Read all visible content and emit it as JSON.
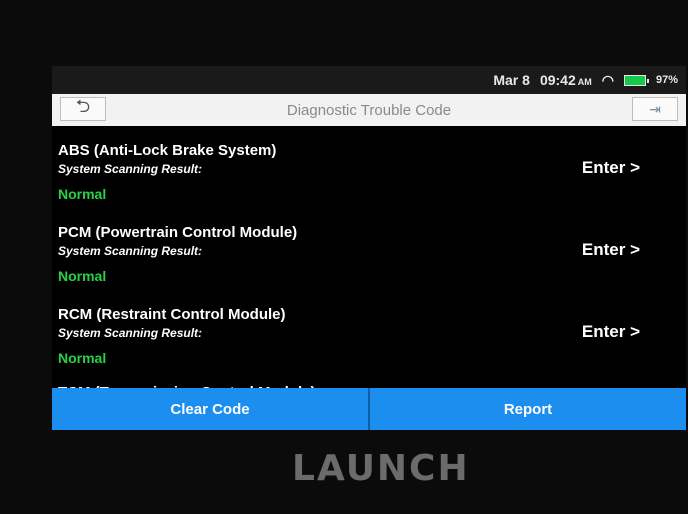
{
  "status_bar": {
    "date": "Mar 8",
    "time": "09:42",
    "ampm": "AM",
    "battery": "97%"
  },
  "header": {
    "title": "Diagnostic Trouble Code"
  },
  "modules": [
    {
      "name": "ABS (Anti-Lock Brake System)",
      "sub": "System Scanning Result:",
      "status": "Normal",
      "action": "Enter >"
    },
    {
      "name": "PCM (Powertrain Control Module)",
      "sub": "System Scanning Result:",
      "status": "Normal",
      "action": "Enter >"
    },
    {
      "name": "RCM (Restraint Control Module)",
      "sub": "System Scanning Result:",
      "status": "Normal",
      "action": "Enter >"
    }
  ],
  "partial_item": "TCM (Transmission Control Module)",
  "bottom": {
    "clear_label": "Clear Code",
    "report_label": "Report"
  },
  "device": {
    "brand": "LAUNCH"
  },
  "icons": {
    "back": "back-arrow-icon",
    "exit": "exit-icon",
    "wifi": "wifi-icon",
    "battery": "battery-icon"
  },
  "colors": {
    "normal_status": "#26d247",
    "action_bar": "#1c8ef0"
  }
}
